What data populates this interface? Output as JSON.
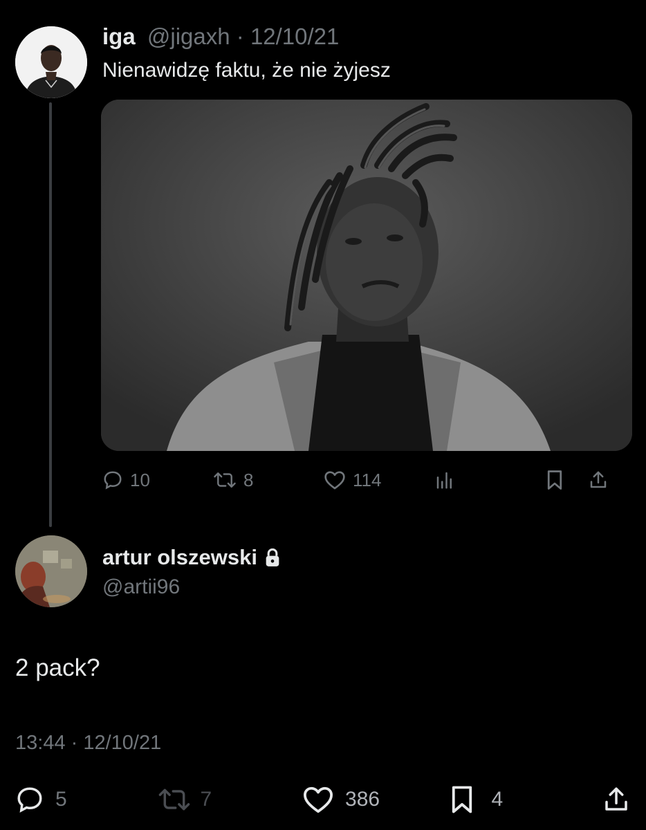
{
  "parent_tweet": {
    "name": "iga",
    "handle": "@jigaxh",
    "separator": "·",
    "date": "12/10/21",
    "text": "Nienawidzę faktu, że nie żyjesz",
    "actions": {
      "replies": "10",
      "retweets": "8",
      "likes": "114"
    }
  },
  "reply_tweet": {
    "name": "artur olszewski",
    "handle": "@artii96",
    "text": "2 pack?",
    "timestamp": "13:44 · 12/10/21",
    "actions": {
      "replies": "5",
      "retweets": "7",
      "likes": "386",
      "bookmarks": "4"
    }
  },
  "icons": {
    "reply": "reply-icon",
    "retweet": "retweet-icon",
    "like": "heart-icon",
    "views": "views-icon",
    "bookmark": "bookmark-icon",
    "share": "share-icon",
    "lock": "lock-icon"
  },
  "colors": {
    "background": "#000000",
    "text": "#e7e9ea",
    "muted": "#71767b",
    "thread_line": "#3a3d41"
  }
}
